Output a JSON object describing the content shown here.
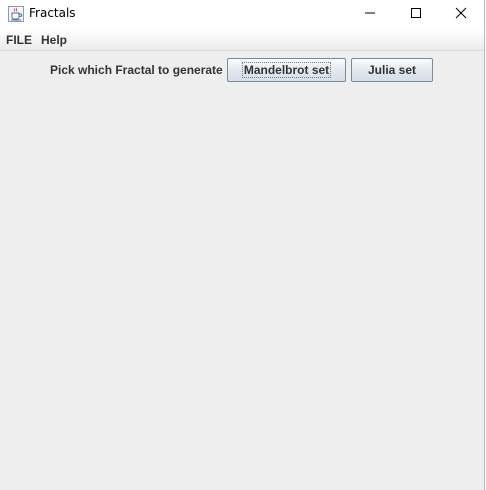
{
  "window": {
    "title": "Fractals",
    "icon": "java-cup-icon"
  },
  "titlebar_controls": [
    "minimize-icon",
    "maximize-icon",
    "close-icon"
  ],
  "menubar": {
    "items": [
      {
        "label": "FILE"
      },
      {
        "label": "Help"
      }
    ]
  },
  "main": {
    "prompt": "Pick which Fractal to generate",
    "buttons": [
      {
        "label": "Mandelbrot set",
        "focused": true
      },
      {
        "label": "Julia set",
        "focused": false
      }
    ]
  }
}
